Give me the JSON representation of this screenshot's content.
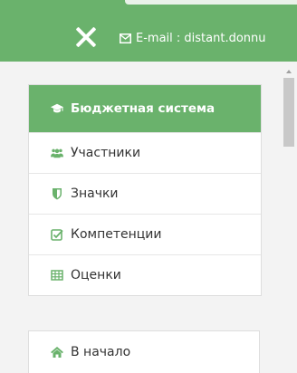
{
  "header": {
    "email_text": "E-mail : distant.donnu"
  },
  "nav": {
    "items": [
      {
        "label": "Бюджетная система",
        "icon": "graduation-cap-icon",
        "active": true
      },
      {
        "label": "Участники",
        "icon": "users-icon"
      },
      {
        "label": "Значки",
        "icon": "shield-icon"
      },
      {
        "label": "Компетенции",
        "icon": "checkbox-icon"
      },
      {
        "label": "Оценки",
        "icon": "table-icon"
      }
    ],
    "home": {
      "label": "В начало",
      "icon": "home-icon"
    }
  },
  "colors": {
    "accent": "#6ab26c",
    "icon": "#6ab26c",
    "text": "#333333"
  }
}
